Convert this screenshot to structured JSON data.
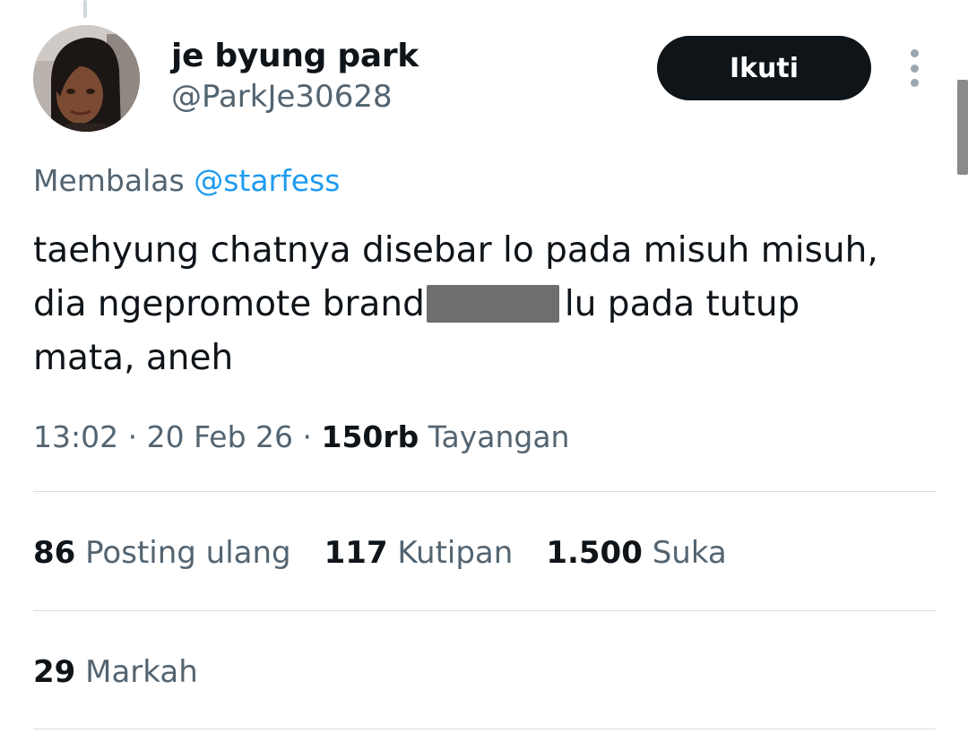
{
  "author": {
    "display_name": "je byung park",
    "handle": "@ParkJe30628",
    "avatar": "profile-photo"
  },
  "follow_button": {
    "label": "Ikuti"
  },
  "more_icon": "more-vertical-icon",
  "reply_context": {
    "prefix": "Membalas",
    "mention": "@starfess"
  },
  "tweet": {
    "line1": "taehyung chatnya disebar lo pada misuh misuh,",
    "line2_before": "dia ngepromote brand",
    "line2_after": "lu pada tutup",
    "line3": "mata, aneh"
  },
  "meta": {
    "time": "13:02",
    "separator": "·",
    "date": "20 Feb 26",
    "views_count": "150rb",
    "views_label": "Tayangan"
  },
  "stats": {
    "reposts": {
      "count": "86",
      "label": "Posting ulang"
    },
    "quotes": {
      "count": "117",
      "label": "Kutipan"
    },
    "likes": {
      "count": "1.500",
      "label": "Suka"
    }
  },
  "bookmarks": {
    "count": "29",
    "label": "Markah"
  },
  "colors": {
    "text_primary": "#0f1419",
    "text_secondary": "#536471",
    "link": "#1d9bf0",
    "button_bg": "#0f1419",
    "divider": "#d6dde2"
  }
}
